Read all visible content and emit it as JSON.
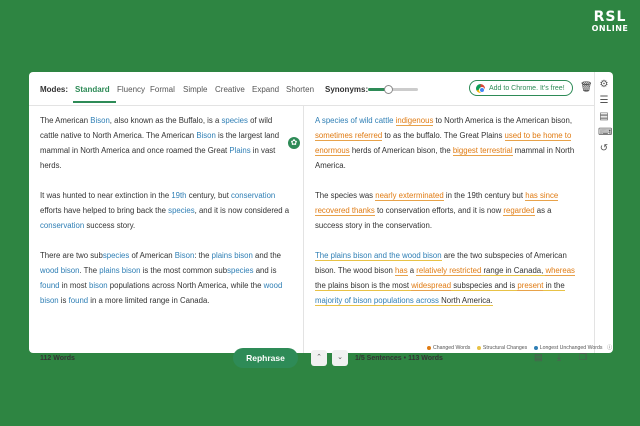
{
  "logo": {
    "line1": "RSL",
    "line2": "ONLINE"
  },
  "toolbar": {
    "modes_label": "Modes:",
    "modes": [
      "Standard",
      "Fluency",
      "Formal",
      "Simple",
      "Creative",
      "Expand",
      "Shorten"
    ],
    "active_mode": "Standard",
    "synonyms_label": "Synonyms:",
    "synonyms_level": 0.4,
    "chrome_button": "Add to Chrome. It's free!"
  },
  "input": {
    "p1": {
      "a": "The American ",
      "b": "Bison",
      ",c": "",
      "c": ", also known as the Buffalo, is a ",
      "d": "species",
      "e": " of wild cattle native to North America. The American ",
      "f": "Bison",
      "g": " is the largest land mammal in North America and once roamed the Great ",
      "h": "Plains",
      "i": " in vast herds."
    },
    "p2": {
      "a": "It was hunted to near extinction in the ",
      "b": "19th",
      "c": " century, but ",
      "d": "conservation",
      "e": " efforts have helped to bring back the ",
      "f": "species",
      "g": ", and it is now considered a ",
      "h": "conservation",
      "i": " success story."
    },
    "p3": {
      "a": "There are two sub",
      "b": "species",
      "c": " of American ",
      "d": "Bison",
      "e": ": the ",
      "f": "plains",
      "g": " ",
      "h": "bison",
      "i": " and the ",
      "j": "wood bison",
      "k": ". The ",
      "l": "plains",
      "m": " ",
      "n": "bison",
      "o": " is the most common sub",
      "p": "species",
      "q": " and is ",
      "r": "found",
      "s": " in most ",
      "t": "bison",
      "u": " populations across North America, while the ",
      "v": "wood bison",
      "w": " is ",
      "x": "found",
      "y": " in a more limited range in Canada."
    },
    "word_count": "112 Words",
    "rephrase_label": "Rephrase"
  },
  "output": {
    "p1": {
      "a": "A species of wild cattle",
      "b": " ",
      "c": "indigenous",
      "d": " to North America is the American bison, ",
      "e": "sometimes referred",
      "f": " to as the buffalo. The Great Plains ",
      "g": "used to be home to",
      "h": " ",
      "i": "enormous",
      "j": " herds of American bison, the ",
      "k": "biggest terrestrial",
      "l": " mammal in North America."
    },
    "p2": {
      "a": "The species was ",
      "b": "nearly exterminated",
      "c": " in the 19th century but ",
      "d": "has since recovered thanks",
      "e": " to conservation efforts, and it is now ",
      "f": "regarded",
      "g": " as a success story in the conservation."
    },
    "p3": {
      "a": "The plains bison and the wood bison",
      "b": " are the two subspecies of American bison. The wood bison ",
      "c": "has",
      "d": " a ",
      "e": "relatively restricted",
      "f": " range in Canada, ",
      "g": "whereas",
      "h": " the plains bison is the most ",
      "i": "widespread",
      "j": " subspecies and is ",
      "k": "present",
      "l": " in the ",
      "m": "majority of bison populations across",
      "n": " North America."
    },
    "sentences": "1/5 Sentences",
    "separator": "•",
    "word_count": "113 Words"
  },
  "legend": {
    "changed": "Changed Words",
    "structural": "Structural Changes",
    "longest": "Longest Unchanged Words"
  },
  "colors": {
    "accent": "#2e8b57",
    "changed": "#e07b12",
    "structural": "#e8c246",
    "longest": "#2f7fb5",
    "background": "#2e8542"
  }
}
